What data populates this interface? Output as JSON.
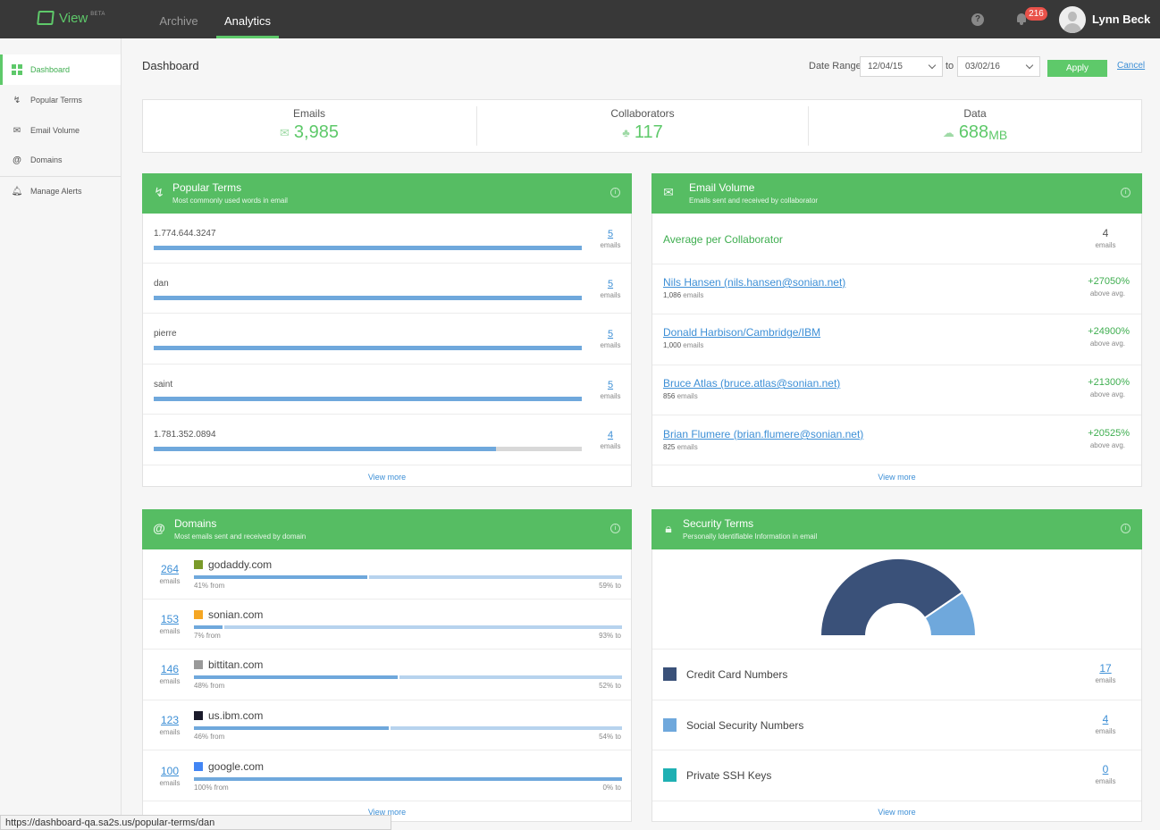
{
  "app": {
    "name": "View",
    "beta": "BETA"
  },
  "nav": {
    "tabs": [
      {
        "label": "Archive"
      },
      {
        "label": "Analytics"
      }
    ]
  },
  "user": {
    "name": "Lynn Beck",
    "notifications": "216"
  },
  "sidebar": {
    "items": [
      {
        "label": "Dashboard",
        "icon": "grid-icon"
      },
      {
        "label": "Popular Terms",
        "icon": "lightning-icon"
      },
      {
        "label": "Email Volume",
        "icon": "envelope-icon"
      },
      {
        "label": "Domains",
        "icon": "at-icon"
      },
      {
        "label": "Manage Alerts",
        "icon": "bell-icon"
      }
    ]
  },
  "header": {
    "title": "Dashboard",
    "date_range_label": "Date Range",
    "from": "12/04/15",
    "to_label": "to",
    "to": "03/02/16",
    "apply": "Apply",
    "cancel": "Cancel"
  },
  "stats": [
    {
      "label": "Emails",
      "value": "3,985",
      "unit": ""
    },
    {
      "label": "Collaborators",
      "value": "117",
      "unit": ""
    },
    {
      "label": "Data",
      "value": "688",
      "unit": "MB"
    }
  ],
  "popular_terms": {
    "title": "Popular Terms",
    "subtitle": "Most commonly used words in email",
    "unit": "emails",
    "view_more": "View more",
    "rows": [
      {
        "term": "1.774.644.3247",
        "count": "5",
        "fraction": 1.0
      },
      {
        "term": "dan",
        "count": "5",
        "fraction": 1.0
      },
      {
        "term": "pierre",
        "count": "5",
        "fraction": 1.0
      },
      {
        "term": "saint",
        "count": "5",
        "fraction": 1.0
      },
      {
        "term": "1.781.352.0894",
        "count": "4",
        "fraction": 0.8
      }
    ]
  },
  "email_volume": {
    "title": "Email Volume",
    "subtitle": "Emails sent and received by collaborator",
    "avg_label": "Average per Collaborator",
    "avg_value": "4",
    "avg_unit": "emails",
    "above_label": "above avg.",
    "view_more": "View more",
    "rows": [
      {
        "name": "Nils Hansen (nils.hansen@sonian.net)",
        "count": "1,086",
        "unit": "emails",
        "pct": "+27050%"
      },
      {
        "name": "Donald Harbison/Cambridge/IBM",
        "count": "1,000",
        "unit": "emails",
        "pct": "+24900%"
      },
      {
        "name": "Bruce Atlas (bruce.atlas@sonian.net)",
        "count": "856",
        "unit": "emails",
        "pct": "+21300%"
      },
      {
        "name": "Brian Flumere (brian.flumere@sonian.net)",
        "count": "825",
        "unit": "emails",
        "pct": "+20525%"
      }
    ]
  },
  "domains": {
    "title": "Domains",
    "subtitle": "Most emails sent and received by domain",
    "unit": "emails",
    "view_more": "View more",
    "rows": [
      {
        "count": "264",
        "domain": "godaddy.com",
        "from_pct": 41,
        "from": "41% from",
        "to": "59% to",
        "favicon_color": "#7a9a2a"
      },
      {
        "count": "153",
        "domain": "sonian.com",
        "from_pct": 7,
        "from": "7% from",
        "to": "93% to",
        "favicon_color": "#f5a623"
      },
      {
        "count": "146",
        "domain": "bittitan.com",
        "from_pct": 48,
        "from": "48% from",
        "to": "52% to",
        "favicon_color": "#999999"
      },
      {
        "count": "123",
        "domain": "us.ibm.com",
        "from_pct": 46,
        "from": "46% from",
        "to": "54% to",
        "favicon_color": "#1a1a2a"
      },
      {
        "count": "100",
        "domain": "google.com",
        "from_pct": 100,
        "from": "100% from",
        "to": "0% to",
        "favicon_color": "#4285f4"
      }
    ]
  },
  "security": {
    "title": "Security Terms",
    "subtitle": "Personally Identifiable Information in email",
    "unit": "emails",
    "view_more": "View more",
    "rows": [
      {
        "label": "Credit Card Numbers",
        "count": "17",
        "value": 17,
        "color": "#3a5179"
      },
      {
        "label": "Social Security Numbers",
        "count": "4",
        "value": 4,
        "color": "#6fa8dc"
      },
      {
        "label": "Private SSH Keys",
        "count": "0",
        "value": 0,
        "color": "#1fb0b3"
      }
    ]
  },
  "statusbar": {
    "url": "https://dashboard-qa.sa2s.us/popular-terms/dan"
  }
}
